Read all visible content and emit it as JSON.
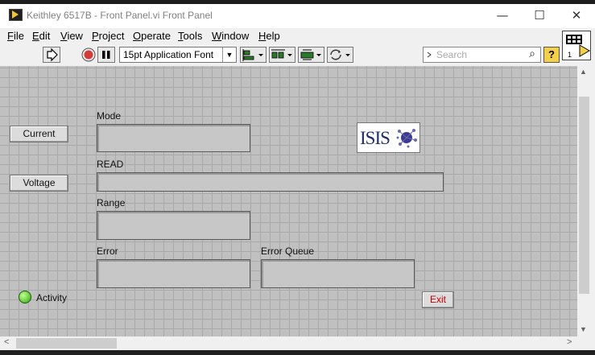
{
  "window": {
    "title": "Keithley 6517B - Front Panel.vi Front Panel",
    "controls": {
      "minimize": "—",
      "maximize": "☐",
      "close": "✕"
    }
  },
  "menu": [
    "File",
    "Edit",
    "View",
    "Project",
    "Operate",
    "Tools",
    "Window",
    "Help"
  ],
  "toolbar": {
    "font": "15pt Application Font",
    "search_placeholder": "Search",
    "help_label": "?",
    "icons": [
      "run-arrow-icon",
      "abort-icon",
      "pause-icon",
      "align-icon",
      "distribute-icon",
      "resize-icon",
      "reorder-icon",
      "search-icon",
      "help-icon"
    ]
  },
  "vi_icon_label": "1",
  "panel": {
    "buttons": {
      "current": "Current",
      "voltage": "Voltage",
      "exit": "Exit"
    },
    "labels": {
      "mode": "Mode",
      "read": "READ",
      "range": "Range",
      "error": "Error",
      "error_queue": "Error Queue",
      "activity": "Activity"
    },
    "logo_text": "ISIS",
    "activity_led_on": true
  },
  "colors": {
    "panel_bg": "#c0c0c0",
    "grid": "#a9a9a9",
    "led": "#2aa80d",
    "exit_text": "#c80000",
    "logo_text": "#1c2e6c"
  }
}
